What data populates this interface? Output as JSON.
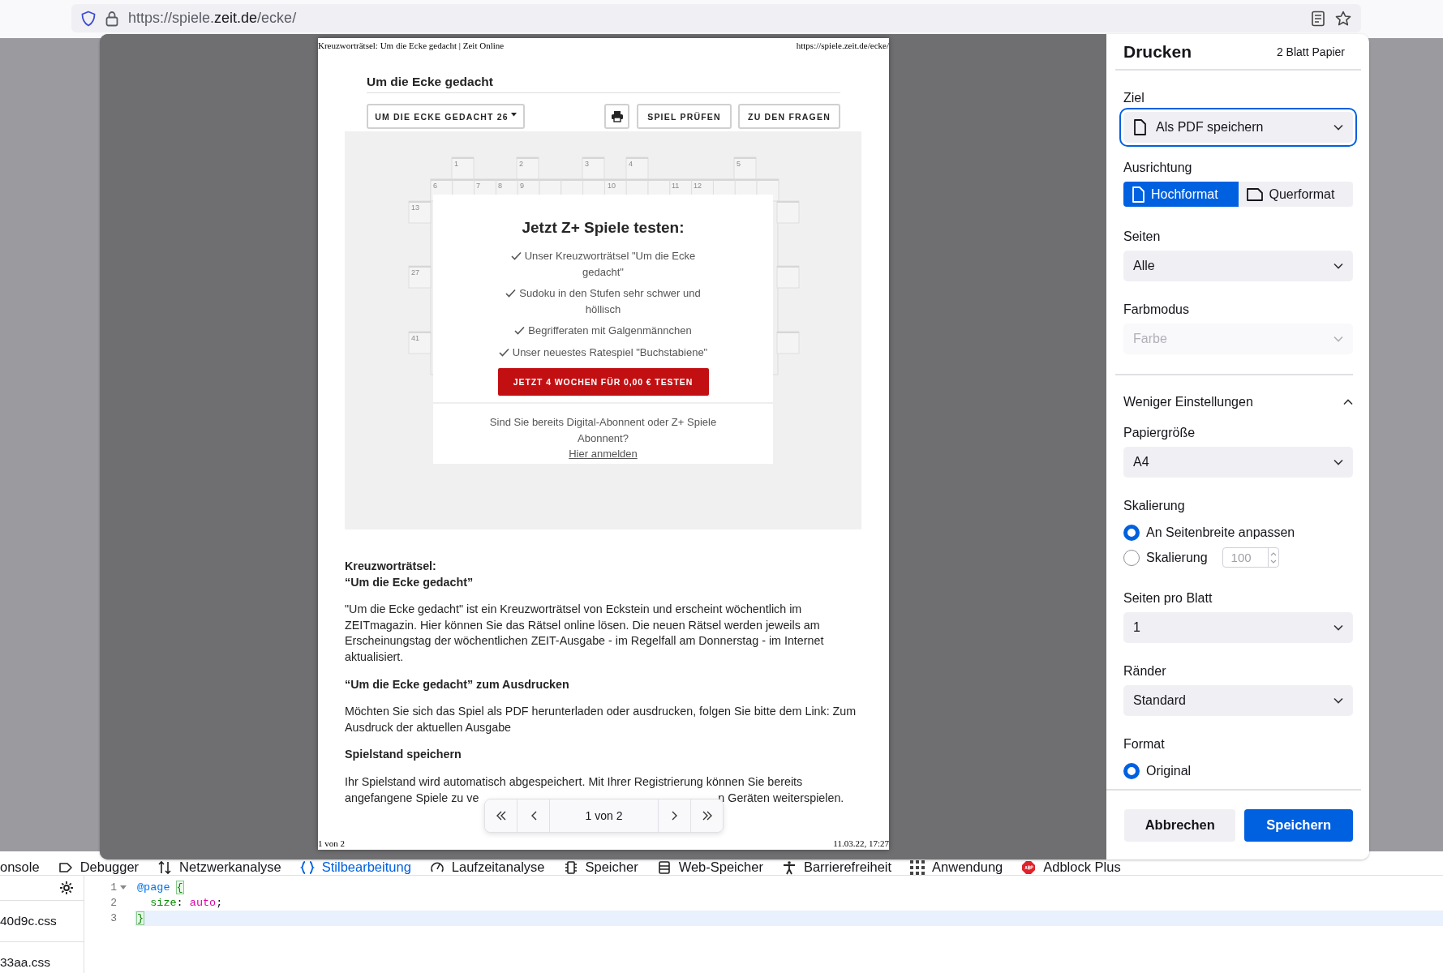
{
  "browser": {
    "url": {
      "prefix": "https://spiele.",
      "domain": "zeit.de",
      "path": "/ecke/"
    }
  },
  "preview": {
    "header_left": "Kreuzworträtsel: Um die Ecke gedacht | Zeit Online",
    "header_right": "https://spiele.zeit.de/ecke/",
    "game_title": "Um die Ecke gedacht",
    "toolbar": [
      {
        "kind": "dropdown",
        "label": "UM DIE ECKE GEDACHT 26"
      },
      {
        "kind": "print"
      },
      {
        "kind": "button",
        "label": "SPIEL PRÜFEN"
      },
      {
        "kind": "button",
        "label": "ZU DEN FRAGEN"
      }
    ],
    "grid_numbers": [
      "1",
      "2",
      "3",
      "4",
      "5",
      "6",
      "7",
      "8",
      "9",
      "10",
      "11",
      "12",
      "13",
      "27",
      "41"
    ],
    "paywall": {
      "title": "Jetzt Z+ Spiele testen:",
      "features": [
        "Unser Kreuzworträtsel \"Um die Ecke gedacht\"",
        "Sudoku in den Stufen sehr schwer und höllisch",
        "Begrifferaten mit Galgenmännchen",
        "Unser neuestes Ratespiel \"Buchstabiene\""
      ],
      "cta": "JETZT 4 WOCHEN FÜR 0,00 € TESTEN",
      "login_prompt": "Sind Sie bereits Digital-Abonnent oder Z+ Spiele Abonnent?",
      "login_link": "Hier anmelden"
    },
    "article": [
      {
        "kind": "heading",
        "lines": [
          "Kreuzworträtsel:",
          "“Um die Ecke gedacht”"
        ]
      },
      {
        "kind": "paragraph",
        "lines": [
          "\"Um die Ecke gedacht\" ist ein Kreuzworträtsel von Eckstein und erscheint wöchentlich im ZEITmagazin. Hier können Sie das Rätsel online lösen. Die neuen Rätsel werden jeweils am Erscheinungstag der wöchentlichen ZEIT-Ausgabe - im Regelfall am Donnerstag - im Internet aktualisiert."
        ]
      },
      {
        "kind": "heading",
        "lines": [
          "“Um die Ecke gedacht” zum Ausdrucken"
        ]
      },
      {
        "kind": "paragraph",
        "lines": [
          "Möchten Sie sich das Spiel als PDF herunterladen oder ausdrucken, folgen Sie bitte dem Link: Zum Ausdruck der aktuellen Ausgabe"
        ]
      },
      {
        "kind": "heading",
        "lines": [
          "Spielstand speichern"
        ]
      },
      {
        "kind": "covered-paragraph",
        "lines": [
          "Ihr Spielstand wird automatisch abgespeichert. Mit Ihrer Registrierung können Sie bereits",
          "angefangene Spiele zu ve",
          "n Geräten weiterspielen."
        ]
      }
    ],
    "footer_left": "1 von 2",
    "footer_right": "11.03.22, 17:27",
    "pager": {
      "label": "1 von 2"
    }
  },
  "print_dialog": {
    "title": "Drucken",
    "sheet_count": "2 Blatt Papier",
    "settings": [
      {
        "kind": "destination",
        "label": "Ziel",
        "value": "Als PDF speichern",
        "focused": true
      },
      {
        "kind": "segmented",
        "label": "Ausrichtung",
        "options": [
          {
            "label": "Hochformat",
            "selected": true
          },
          {
            "label": "Querformat",
            "selected": false
          }
        ]
      },
      {
        "kind": "select",
        "label": "Seiten",
        "value": "Alle",
        "disabled": false
      },
      {
        "kind": "select",
        "label": "Farbmodus",
        "value": "Farbe",
        "disabled": true
      },
      {
        "kind": "toggle",
        "label": "Weniger Einstellungen",
        "expanded": true
      },
      {
        "kind": "select",
        "label": "Papiergröße",
        "value": "A4",
        "disabled": false
      },
      {
        "kind": "radios",
        "label": "Skalierung",
        "options": [
          {
            "label": "An Seitenbreite anpassen",
            "selected": true
          },
          {
            "label": "Skalierung",
            "selected": false,
            "input": "100"
          }
        ]
      },
      {
        "kind": "select",
        "label": "Seiten pro Blatt",
        "value": "1",
        "disabled": false
      },
      {
        "kind": "select",
        "label": "Ränder",
        "value": "Standard",
        "disabled": false
      },
      {
        "kind": "radios",
        "label": "Format",
        "options": [
          {
            "label": "Original",
            "selected": true
          }
        ]
      }
    ],
    "buttons": [
      {
        "label": "Abbrechen",
        "primary": false
      },
      {
        "label": "Speichern",
        "primary": true
      }
    ]
  },
  "devtools": {
    "tabs": [
      {
        "label": "onsole",
        "selected": false
      },
      {
        "label": "Debugger",
        "selected": false
      },
      {
        "label": "Netzwerkanalyse",
        "selected": false
      },
      {
        "label": "Stilbearbeitung",
        "selected": true
      },
      {
        "label": "Laufzeitanalyse",
        "selected": false
      },
      {
        "label": "Speicher",
        "selected": false
      },
      {
        "label": "Web-Speicher",
        "selected": false
      },
      {
        "label": "Barrierefreiheit",
        "selected": false
      },
      {
        "label": "Anwendung",
        "selected": false
      },
      {
        "label": "Adblock Plus",
        "selected": false
      }
    ],
    "files": [
      "40d9c.css",
      "33aa.css"
    ],
    "code_lines": [
      {
        "number": "1",
        "highlighted": false,
        "tokens": [
          {
            "kind": "keyword",
            "text": "@page"
          },
          {
            "kind": "bracket",
            "text": "{"
          }
        ]
      },
      {
        "number": "2",
        "highlighted": false,
        "tokens": [
          {
            "kind": "property",
            "text": "size"
          },
          {
            "kind": "punct",
            "text": ":"
          },
          {
            "kind": "value",
            "text": "auto"
          },
          {
            "kind": "punct",
            "text": ";"
          }
        ]
      },
      {
        "number": "3",
        "highlighted": true,
        "tokens": [
          {
            "kind": "bracket",
            "text": "}"
          }
        ]
      }
    ]
  }
}
